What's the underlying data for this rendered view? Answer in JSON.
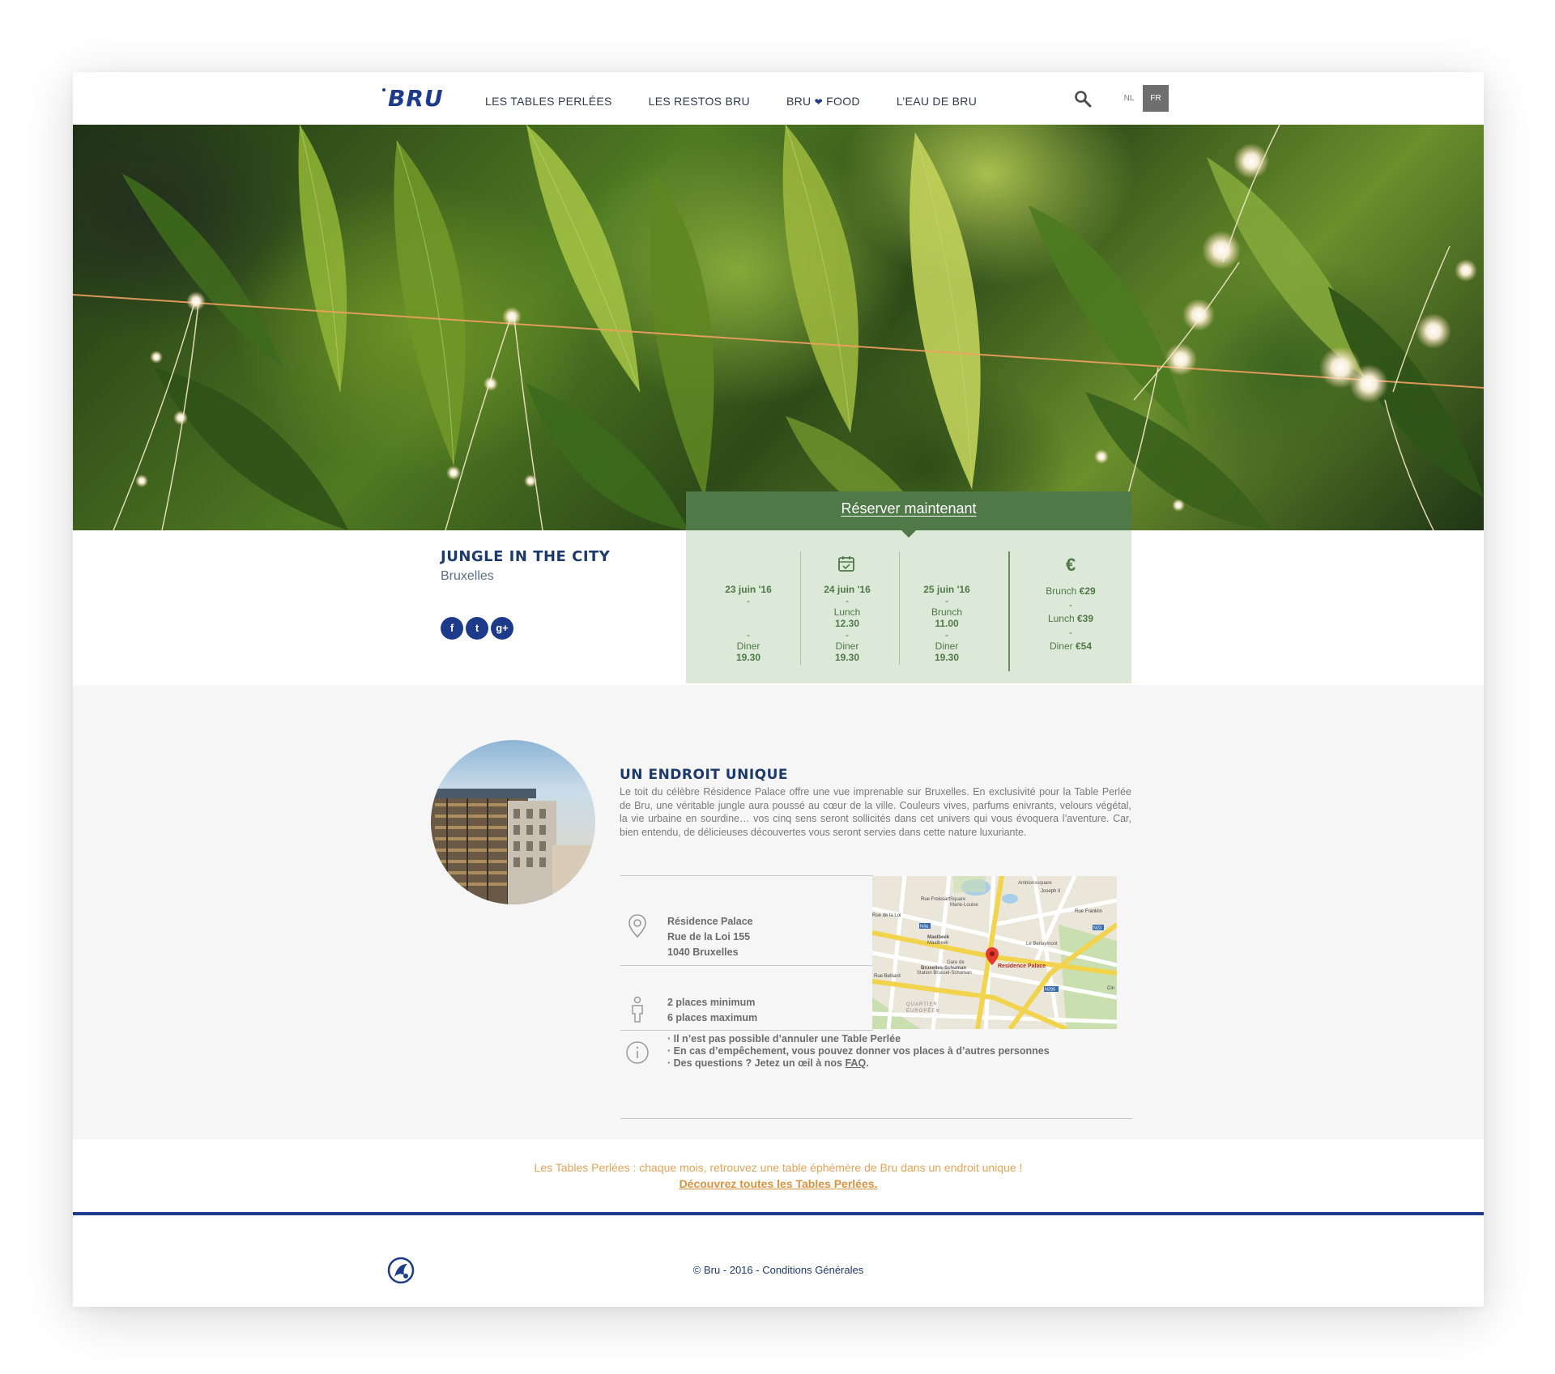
{
  "header": {
    "logo_text": "BRU",
    "nav": [
      "LES TABLES PERLÉES",
      "LES RESTOS BRU",
      "FOOD",
      "L’EAU DE BRU"
    ],
    "nav_bru_food_prefix": "BRU",
    "heart": "❤",
    "languages": [
      "NL",
      "FR"
    ],
    "active_language": "FR"
  },
  "event": {
    "title": "JUNGLE IN THE CITY",
    "city": "Bruxelles",
    "social": [
      "f",
      "t",
      "g+"
    ]
  },
  "booking": {
    "cta": "Réserver maintenant",
    "dates": [
      {
        "date": "23 juin '16",
        "dash1": "-",
        "lunch": "",
        "lunch_time": "",
        "dash2": "-",
        "diner": "Diner",
        "diner_time": "19.30"
      },
      {
        "date": "24 juin '16",
        "dash1": "-",
        "lunch": "Lunch",
        "lunch_time": "12.30",
        "dash2": "-",
        "diner": "Diner",
        "diner_time": "19.30"
      },
      {
        "date": "25 juin '16",
        "dash1": "-",
        "lunch": "Brunch",
        "lunch_time": "11.00",
        "dash2": "-",
        "diner": "Diner",
        "diner_time": "19.30"
      }
    ],
    "euro_symbol": "€",
    "prices": [
      {
        "label": "Brunch",
        "price": "€29"
      },
      {
        "label": "Lunch",
        "price": "€39"
      },
      {
        "label": "Diner",
        "price": "€54"
      }
    ],
    "price_dash": "-"
  },
  "venue": {
    "title": "UN ENDROIT UNIQUE",
    "description": "Le toit du célèbre Résidence Palace offre une vue imprenable sur Bruxelles. En exclusivité pour la Table Perlée de Bru, une véritable jungle aura poussé au cœur de la ville. Couleurs vives, parfums enivrants, velours végétal, la vie urbaine en sourdine… vos cinq sens seront sollicités dans cet univers qui vous évoquera l’aventure. Car, bien entendu, de délicieuses découvertes vous seront servies dans cette nature luxuriante.",
    "address": [
      "Résidence Palace",
      "Rue de la Loi 155",
      "1040 Bruxelles"
    ],
    "places": [
      "2 places minimum",
      "6 places maximum"
    ],
    "notes": [
      "· Il n’est pas possible d’annuler une Table Perlée",
      "· En cas d’empêchement, vous pouvez donner vos places à d’autres personnes"
    ],
    "note_faq_prefix": "· Des questions ? Jetez un œil à nos ",
    "note_faq_link": "FAQ",
    "note_faq_suffix": "."
  },
  "map": {
    "labels": {
      "marker": "Residence Palace",
      "maelbeek": "Maelbeek",
      "maelbeek_sub": "Maalbeek",
      "gare": "Gare de",
      "gare2": "Bruxelles-Schuman",
      "gare3": "Station Brussel-Schuman",
      "berlaymont": "Le Berlaymont",
      "quartier": "QUARTIER",
      "europeen": "EUROPÉEN",
      "ambiorix": "Ambiorixsquare",
      "square": "Square",
      "marie": "Marie-Louise",
      "belliard": "Rue Belliard",
      "froissart": "Rue Froissart",
      "franklin": "Rue Franklin",
      "n23": "N23",
      "n3a": "N3a",
      "n295": "N295",
      "cin": "Cin",
      "b1": "Rue de la Loi",
      "v": "Joseph II"
    }
  },
  "tagline": {
    "text": "Les Tables Perlées : chaque mois, retrouvez une table éphémère de Bru dans un endroit unique !",
    "link": "Découvrez toutes les Tables Perlées."
  },
  "footer": {
    "copyright_prefix": "© Bru - 2016 - ",
    "conditions": "Conditions Générales"
  },
  "colors": {
    "brand_blue": "#1d3b8a",
    "green_dark": "#4f7947",
    "green_light": "#dce9d8",
    "orange": "#e3a45a"
  },
  "icons": [
    "search-icon",
    "calendar-icon",
    "euro-icon",
    "location-pin-icon",
    "person-icon",
    "info-icon",
    "footer-logo-icon"
  ]
}
